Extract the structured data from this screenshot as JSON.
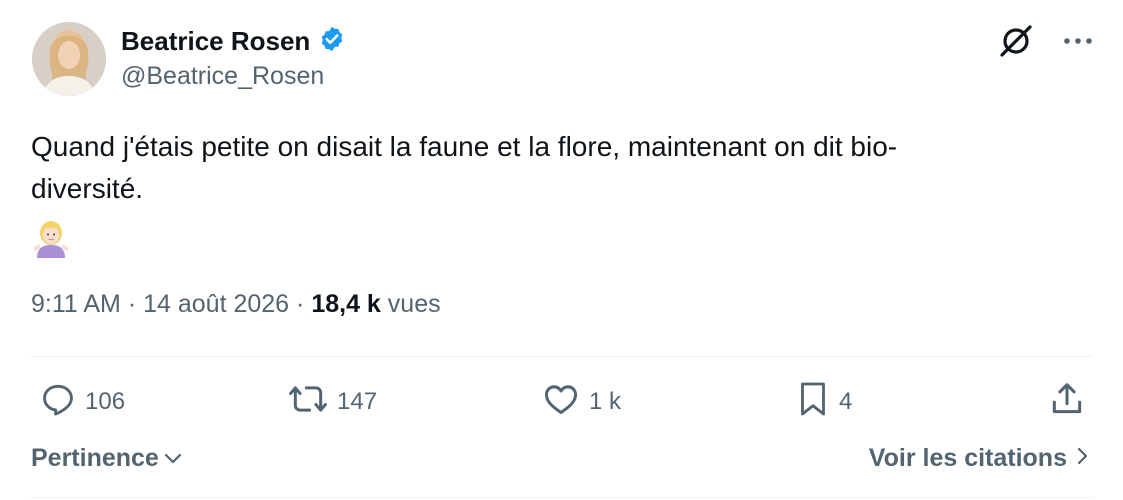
{
  "author": {
    "display_name": "Beatrice Rosen",
    "handle": "@Beatrice_Rosen",
    "verified_badge_icon": "verified-badge-icon",
    "avatar_icon": "profile-photo"
  },
  "header_icons": [
    "grok-icon",
    "more-icon"
  ],
  "tweet": {
    "text": "Quand j'étais petite on disait la faune et la flore, maintenant on dit bio-\ndiversité.",
    "emoji": "woman-shrugging-emoji"
  },
  "meta": {
    "time": "9:11 AM",
    "separator": "·",
    "date": "14 août 2026",
    "views_count": "18,4 k",
    "views_label": "vues"
  },
  "actions": {
    "reply": {
      "icon": "reply-icon",
      "count": "106"
    },
    "repost": {
      "icon": "repost-icon",
      "count": "147"
    },
    "like": {
      "icon": "heart-icon",
      "count": "1 k"
    },
    "bookmark": {
      "icon": "bookmark-icon",
      "count": "4"
    },
    "share": {
      "icon": "share-icon"
    }
  },
  "footer": {
    "sort_label": "Pertinence",
    "quotes_label": "Voir les citations"
  },
  "colors": {
    "text_primary": "#0f1419",
    "text_secondary": "#536471",
    "verified_blue": "#1d9bf0",
    "divider": "#eff3f4"
  }
}
